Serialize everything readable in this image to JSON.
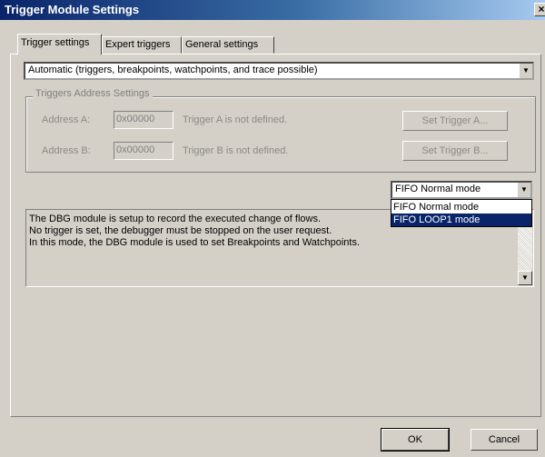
{
  "window": {
    "title": "Trigger Module Settings",
    "close_label": "×"
  },
  "tabs": [
    {
      "label": "Trigger settings",
      "active": true
    },
    {
      "label": "Expert triggers",
      "active": false
    },
    {
      "label": "General settings",
      "active": false
    }
  ],
  "mode_select": {
    "value": "Automatic (triggers, breakpoints, watchpoints, and trace possible)"
  },
  "triggers_group": {
    "title": "Triggers Address Settings",
    "rows": [
      {
        "label": "Address A:",
        "value": "0x00000",
        "status": "Trigger A is not defined.",
        "button": "Set Trigger A..."
      },
      {
        "label": "Address B:",
        "value": "0x00000",
        "status": "Trigger B is not defined.",
        "button": "Set Trigger B..."
      }
    ]
  },
  "fifo_select": {
    "value": "FIFO Normal mode",
    "options": [
      "FIFO Normal mode",
      "FIFO LOOP1 mode"
    ],
    "highlighted": "FIFO LOOP1 mode"
  },
  "description": {
    "lines": [
      "The DBG module is setup to record the executed change of flows.",
      "No trigger is set, the debugger must be stopped on the user request.",
      "In this mode, the DBG module is used to set Breakpoints and Watchpoints."
    ]
  },
  "buttons": {
    "ok": "OK",
    "cancel": "Cancel"
  },
  "colors": {
    "titlebar_start": "#0a246a",
    "titlebar_end": "#a6caf0",
    "face": "#d4d0c8",
    "selection": "#0a246a"
  }
}
